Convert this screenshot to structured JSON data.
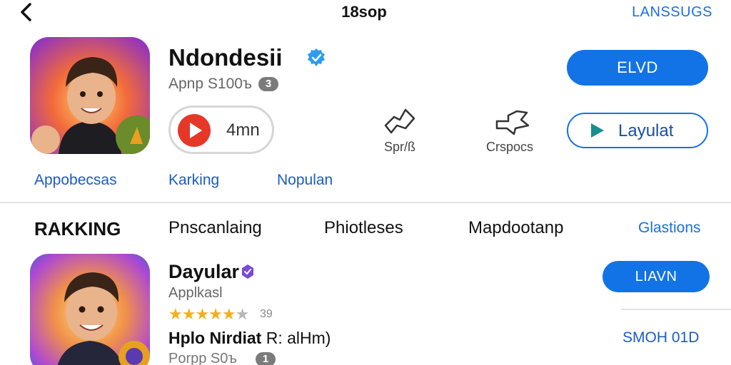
{
  "top_bar": {
    "title": "18sop",
    "right_link": "LANSSUGS"
  },
  "featured_app": {
    "name": "Ndondesii",
    "subtitle": "Apnp S100ъ",
    "badge_count": "3",
    "play_label": "4mn",
    "share_label": "Spr/ß",
    "groups_label": "Crspocs",
    "primary_button": "ELVD",
    "secondary_button": "Layulat",
    "links": [
      "Appobecsas",
      "Karking",
      "Nopulan"
    ]
  },
  "tabs": [
    "RAKKING",
    "Pnscanlaing",
    "Phiotleses",
    "Mapdootanp",
    "Glastions"
  ],
  "second_app": {
    "name": "Dayular",
    "subtitle": "Applkasl",
    "rating_stars": "★★★★★",
    "rating_dim_star": "★",
    "rating_value": "39",
    "description_bold": "Hplo Nirdiat",
    "description_rest": " R: alHm)",
    "price": "Porpp S0ъ",
    "badge_count": "1",
    "button": "LIAVN",
    "right_text": "SMOH 01D"
  },
  "colors": {
    "accent": "#1273e6",
    "link": "#1a5cc8",
    "play_red": "#e53828",
    "star": "#f2b01c"
  }
}
